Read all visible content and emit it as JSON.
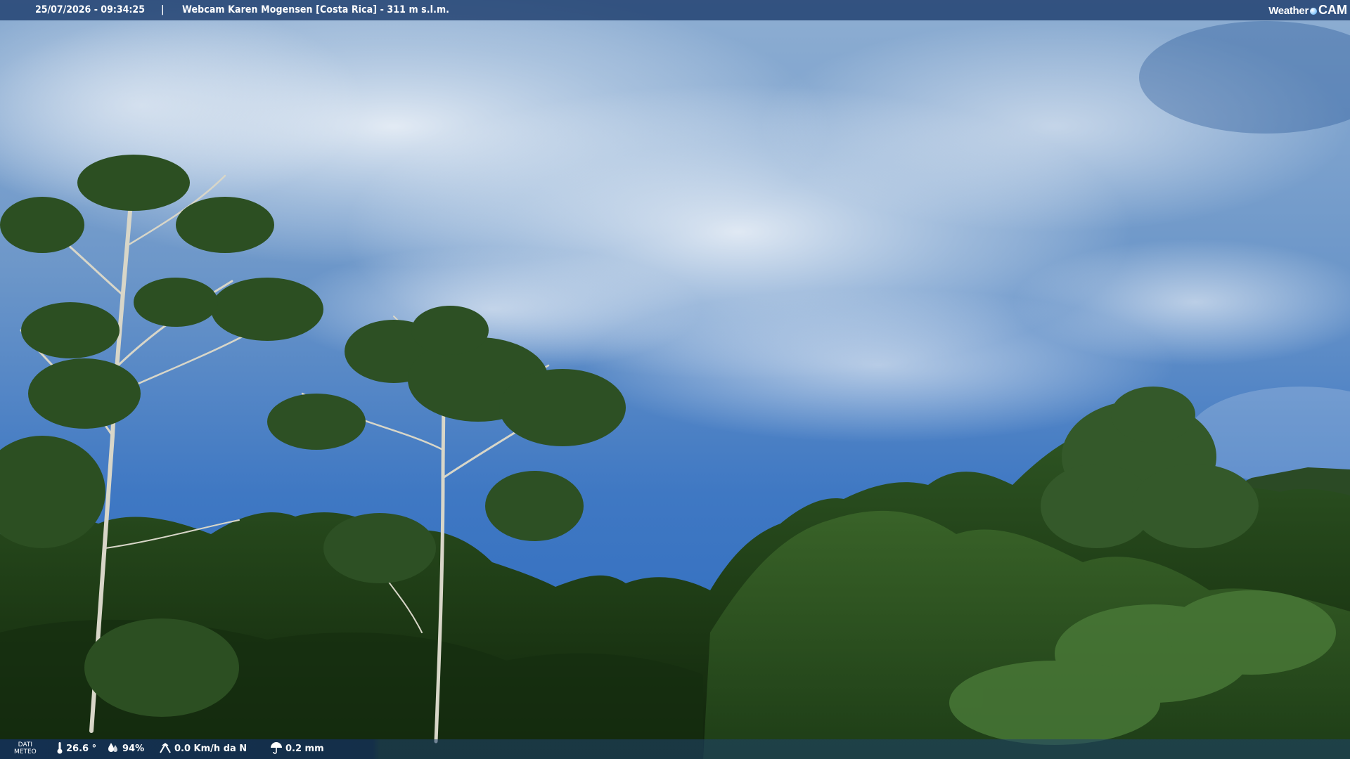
{
  "overlay_top": {
    "datetime": "25/07/2026 - 09:34:25",
    "separator": "|",
    "title": "Webcam Karen Mogensen [Costa Rica]  - 311 m s.l.m.",
    "brand_weather": "Weather",
    "brand_cam": "CAM"
  },
  "overlay_bottom": {
    "label_line1": "DATI",
    "label_line2": "METEO",
    "temperature": "26.6 °",
    "humidity": "94%",
    "wind": "0.0 Km/h da N",
    "rain": "0.2 mm"
  },
  "icons": {
    "temperature": "thermometer-icon",
    "humidity": "droplet-icon",
    "wind": "wind-icon",
    "rain": "umbrella-icon",
    "brand": "weathercam-logo-icon"
  },
  "colors": {
    "sky_top": "#a9c3dc",
    "sky_mid": "#4a7fc0",
    "sky_low": "#2d6cc1",
    "foliage_dark": "#17300f",
    "foliage_mid": "#2f5424",
    "bar": "#1e3e6e"
  }
}
